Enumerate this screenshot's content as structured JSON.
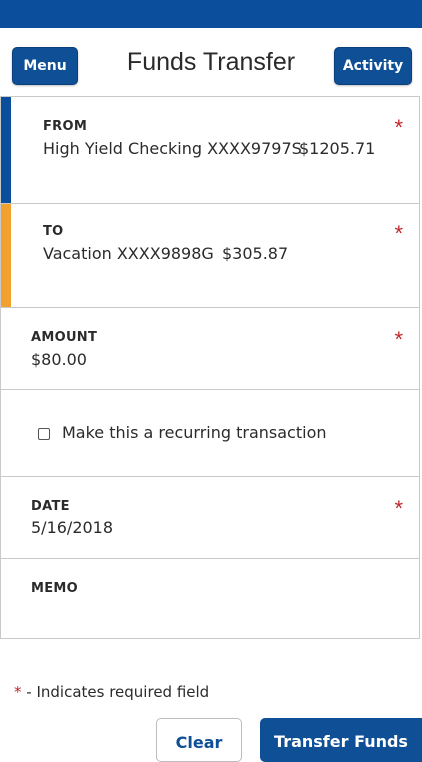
{
  "header": {
    "title": "Funds Transfer",
    "menu_label": "Menu",
    "activity_label": "Activity"
  },
  "from": {
    "label": "FROM",
    "account": "High Yield Checking XXXX9797S",
    "balance": "$1205.71",
    "accent_color": "#0b4f9c"
  },
  "to": {
    "label": "TO",
    "account": "Vacation XXXX9898G",
    "balance": "$305.87",
    "accent_color": "#f2a12e"
  },
  "amount": {
    "label": "AMOUNT",
    "value": "$80.00"
  },
  "recurring": {
    "label": "Make this a recurring transaction",
    "checked": false
  },
  "date": {
    "label": "DATE",
    "value": "5/16/2018"
  },
  "memo": {
    "label": "MEMO",
    "value": ""
  },
  "required_marker": "*",
  "required_note": "- Indicates required field",
  "actions": {
    "clear_label": "Clear",
    "transfer_label": "Transfer Funds"
  },
  "colors": {
    "brand_blue": "#0e4f96",
    "required_red": "#c1272d"
  }
}
